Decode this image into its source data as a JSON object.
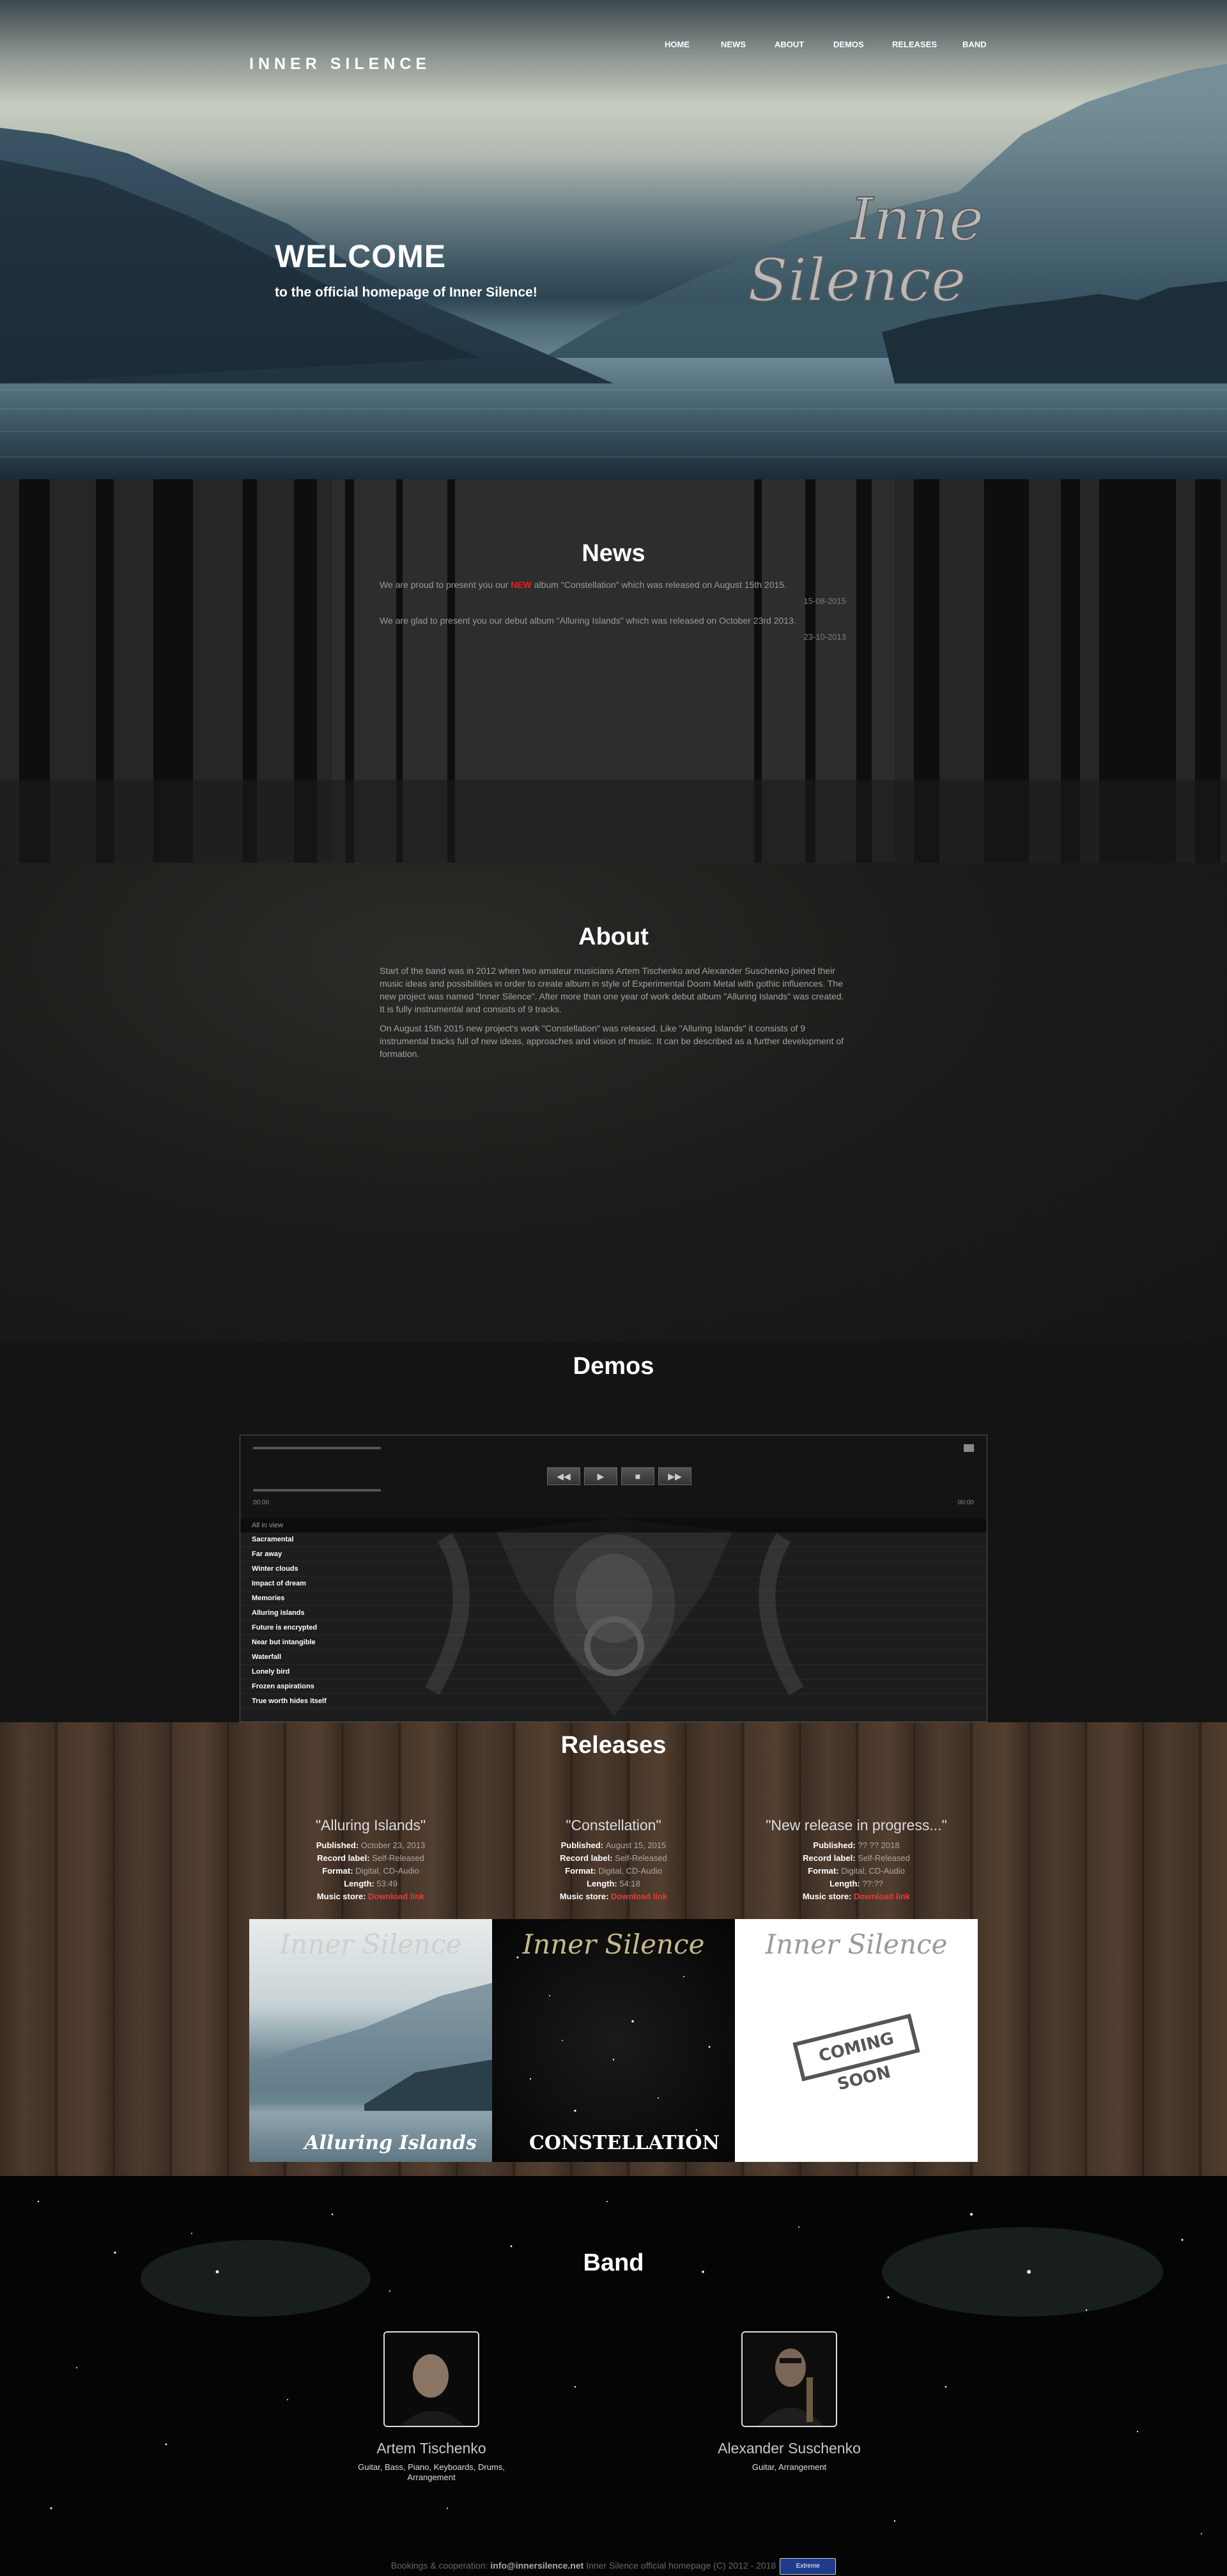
{
  "header": {
    "brand": "INNER SILENCE",
    "nav": [
      "HOME",
      "NEWS",
      "ABOUT",
      "DEMOS",
      "RELEASES",
      "BAND"
    ]
  },
  "hero": {
    "title": "WELCOME",
    "subtitle": "to the official homepage of Inner Silence!",
    "logo_text_1": "Inner",
    "logo_text_2": "Silence"
  },
  "news": {
    "title": "News",
    "items": [
      {
        "text_before": "We are proud to present you our ",
        "highlight": "NEW",
        "text_after": " album \"Constellation\" which was released on August 15th 2015.",
        "date": "15-08-2015"
      },
      {
        "text_before": "We are glad to present you our debut album \"Alluring Islands\" which was released on October 23rd 2013.",
        "highlight": "",
        "text_after": "",
        "date": "23-10-2013"
      }
    ]
  },
  "about": {
    "title": "About",
    "paragraphs": [
      "Start of the band was in 2012 when two amateur musicians Artem Tischenko and Alexander Suschenko joined their music ideas and possibilities in order to create album in style of Experimental Doom Metal with gothic influences. The new project was named \"Inner Silence\". After more than one year of work debut album \"Alluring Islands\" was created. It is fully instrumental and consists of 9 tracks.",
      "On August 15th 2015 new project's work \"Constellation\" was released. Like \"Alluring Islands\" it consists of 9 instrumental tracks full of new ideas, approaches and vision of music. It can be described as a further development of formation."
    ]
  },
  "demos": {
    "title": "Demos",
    "player": {
      "buttons": [
        "◀◀",
        "▶",
        "■",
        "▶▶"
      ],
      "time_left": "00:00",
      "time_right": "00:00",
      "all_label": "All in view",
      "tracks": [
        "Sacramental",
        "Far away",
        "Winter clouds",
        "Impact of dream",
        "Memories",
        "Alluring islands",
        "Future is encrypted",
        "Near but intangible",
        "Waterfall",
        "Lonely bird",
        "Frozen aspirations",
        "True worth hides itself"
      ]
    }
  },
  "releases": {
    "title": "Releases",
    "labels": {
      "published": "Published:",
      "label": "Record label:",
      "format": "Format:",
      "length": "Length:",
      "store": "Music store:"
    },
    "items": [
      {
        "title": "\"Alluring Islands\"",
        "published": "October 23, 2013",
        "label": "Self-Released",
        "format": "Digital, CD-Audio",
        "length": "53:49",
        "store": "Download link",
        "cover_title": "Inner Silence",
        "cover_sub": "Alluring Islands"
      },
      {
        "title": "\"Constellation\"",
        "published": "August 15, 2015",
        "label": "Self-Released",
        "format": "Digital, CD-Audio",
        "length": "54:18",
        "store": "Download link",
        "cover_title": "Inner Silence",
        "cover_sub": "CONSTELLATION"
      },
      {
        "title": "\"New release in progress...\"",
        "published": "?? ?? 2018",
        "label": "Self-Released",
        "format": "Digital, CD-Audio",
        "length": "??:??",
        "store": "Download link",
        "cover_title": "Inner Silence",
        "cover_sub": "COMING SOON"
      }
    ]
  },
  "band": {
    "title": "Band",
    "members": [
      {
        "name": "Artem Tischenko",
        "role": "Guitar, Bass, Piano, Keyboards, Drums, Arrangement"
      },
      {
        "name": "Alexander Suschenko",
        "role": "Guitar, Arrangement"
      }
    ]
  },
  "footer": {
    "before": "Bookings & cooperation: ",
    "email": "info@innersilence.net",
    "after": " Inner Silence official homepage (C) 2012 - 2018",
    "badge": "Extreme"
  }
}
